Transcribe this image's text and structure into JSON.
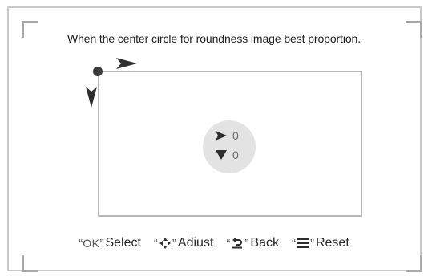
{
  "instruction": "When the center circle for roundness image best proportion.",
  "readout": {
    "horizontal": "0",
    "vertical": "0"
  },
  "hints": [
    {
      "key": "OK",
      "label": "Select"
    },
    {
      "icon": "move-arrows-icon",
      "label": "Adiust"
    },
    {
      "icon": "back-arrow-icon",
      "label": "Back"
    },
    {
      "icon": "menu-lines-icon",
      "label": "Reset"
    }
  ],
  "colors": {
    "frame": "#c9c9c9",
    "corner": "#a9a9a9",
    "rect": "#b8b8b8",
    "circle": "#e3e3e3",
    "marker": "#3a3a3a"
  }
}
